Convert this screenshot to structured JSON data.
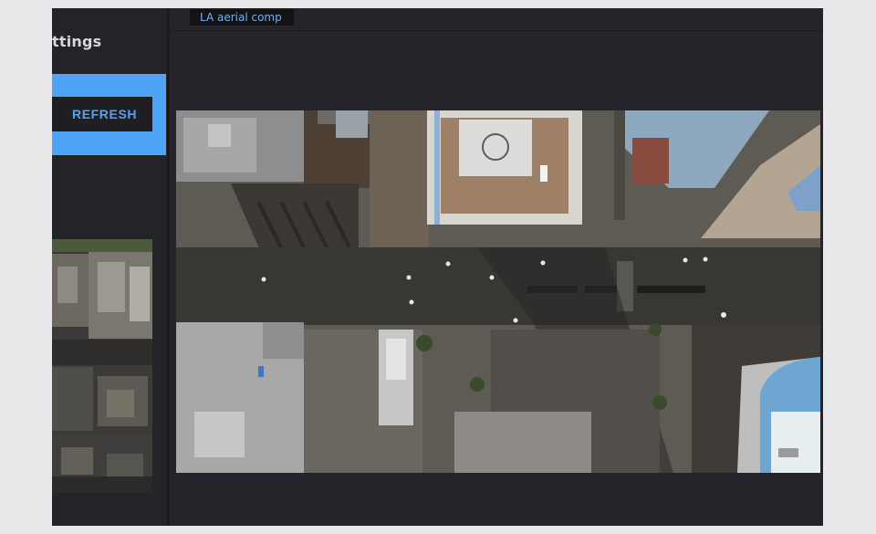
{
  "left_panel": {
    "title": "ttings",
    "refresh_label": "REFRESH"
  },
  "main": {
    "tab_label": "LA aerial comp"
  },
  "colors": {
    "accent": "#4ea4f6",
    "panel_bg": "#242327",
    "button_bg": "#1f1f23"
  }
}
